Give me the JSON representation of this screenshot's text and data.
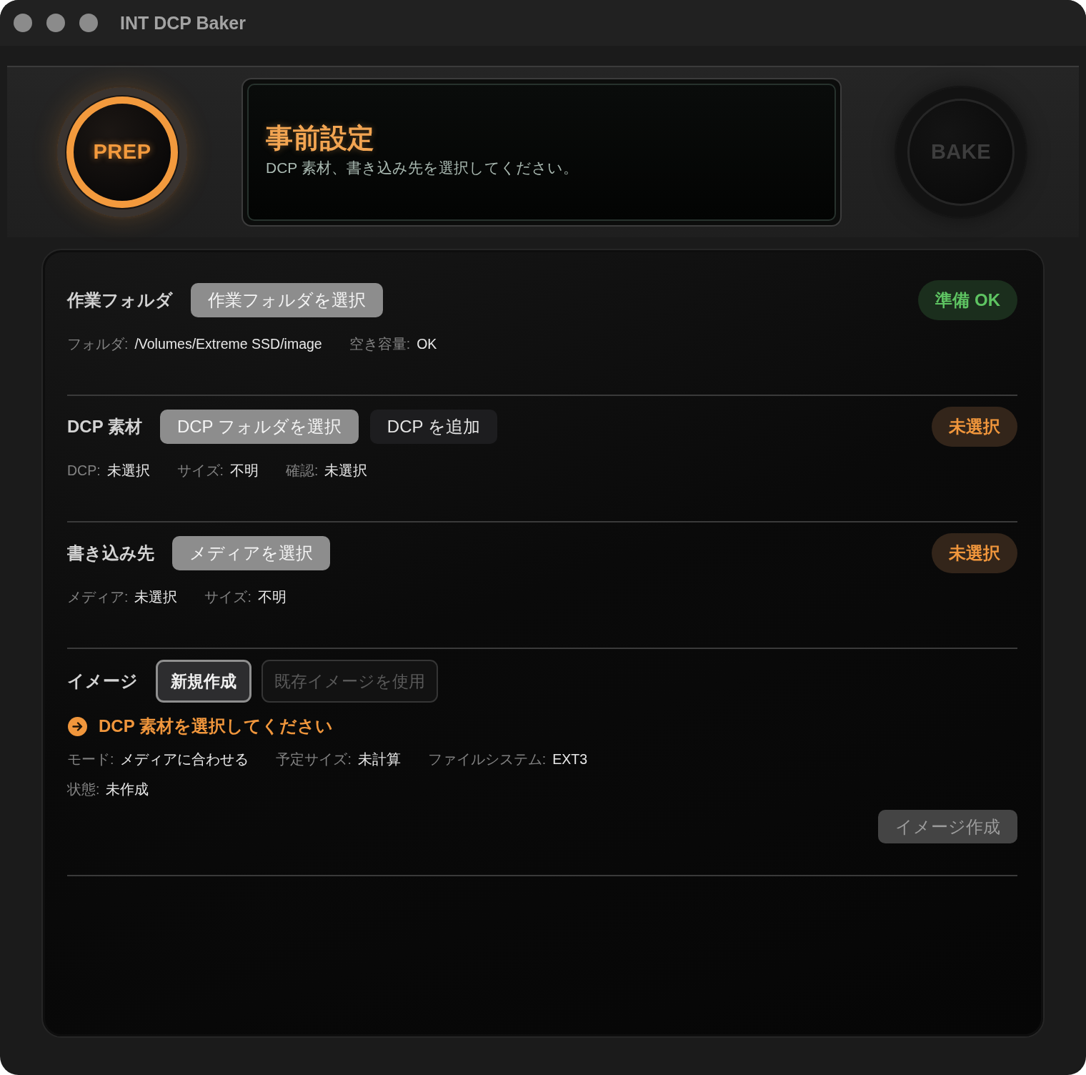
{
  "window": {
    "title": "INT DCP Baker"
  },
  "header": {
    "prep_button": {
      "label": "PREP",
      "on": true
    },
    "display": {
      "title": "事前設定",
      "message": "DCP 素材、書き込み先を選択してください。"
    },
    "bake_button": {
      "label": "BAKE",
      "on": false
    }
  },
  "sections": [
    {
      "heading": "作業フォルダ",
      "buttons": [
        {
          "label": "作業フォルダを選択",
          "kind": "filled"
        }
      ],
      "badge": {
        "text": "準備 OK",
        "ready": true
      },
      "info_rows": [
        [
          {
            "label": "フォルダ:",
            "value": "/Volumes/Extreme SSD/image"
          },
          {
            "label": "空き容量:",
            "value": "OK"
          }
        ]
      ]
    },
    {
      "heading": "DCP 素材",
      "buttons": [
        {
          "label": "DCP フォルダを選択",
          "kind": "filled"
        },
        {
          "label": "DCP を追加",
          "kind": "plain"
        }
      ],
      "badge": {
        "text": "未選択",
        "ready": false
      },
      "info_rows": [
        [
          {
            "label": "DCP:",
            "value": "未選択"
          },
          {
            "label": "サイズ:",
            "value": "不明"
          },
          {
            "label": "確認:",
            "value": "未選択"
          }
        ]
      ]
    },
    {
      "heading": "書き込み先",
      "buttons": [
        {
          "label": "メディアを選択",
          "kind": "filled"
        }
      ],
      "badge": {
        "text": "未選択",
        "ready": false
      },
      "info_rows": [
        [
          {
            "label": "メディア:",
            "value": "未選択"
          },
          {
            "label": "サイズ:",
            "value": "不明"
          }
        ]
      ]
    },
    {
      "heading": "イメージ",
      "options": [
        {
          "label": "新規作成",
          "selected": true
        },
        {
          "label": "既存イメージを使用",
          "selected": false
        }
      ],
      "notice": "DCP 素材を選択してください",
      "info_rows": [
        [
          {
            "label": "モード:",
            "value": "メディアに合わせる"
          },
          {
            "label": "予定サイズ:",
            "value": "未計算"
          },
          {
            "label": "ファイルシステム:",
            "value": "EXT3"
          }
        ],
        [
          {
            "label": "状態:",
            "value": "未作成"
          }
        ]
      ],
      "action": {
        "label": "イメージ作成",
        "disabled": true
      }
    }
  ]
}
